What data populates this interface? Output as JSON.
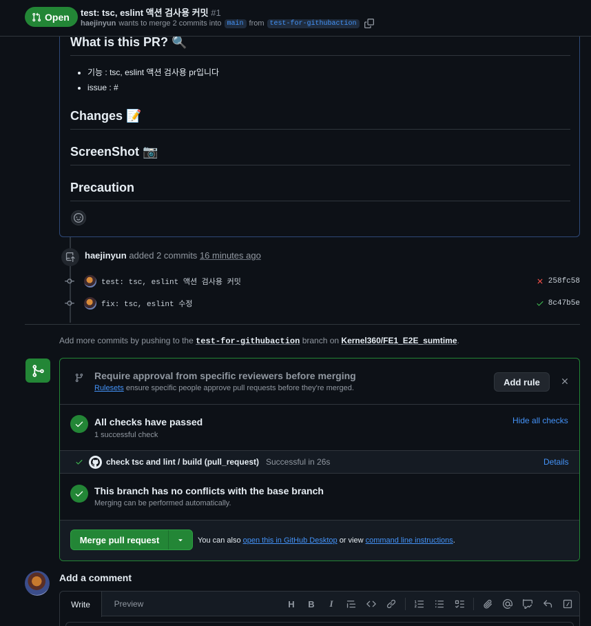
{
  "header": {
    "state": "Open",
    "title": "test: tsc, eslint 액션 검사용 커밋",
    "number": "#1",
    "author": "haejinyun",
    "merge_text": "wants to merge 2 commits into",
    "base_branch": "main",
    "from_text": "from",
    "head_branch": "test-for-githubaction"
  },
  "description": {
    "heading1": "What is this PR? 🔍",
    "items": [
      "기능 : tsc, eslint 액션 검사용 pr입니다",
      "issue : #"
    ],
    "heading2": "Changes 📝",
    "heading3": "ScreenShot 📷",
    "heading4": "Precaution"
  },
  "timeline": {
    "actor": "haejinyun",
    "action": "added 2 commits",
    "time": "16 minutes ago",
    "commits": [
      {
        "message": "test: tsc, eslint 액션 검사용 커밋",
        "sha": "258fc58",
        "status": "fail"
      },
      {
        "message": "fix: tsc, eslint 수정",
        "sha": "8c47b5e",
        "status": "pass"
      }
    ],
    "push_prefix": "Add more commits by pushing to the",
    "push_branch": "test-for-githubaction",
    "push_mid": "branch on",
    "push_repo": "Kernel360/FE1_E2E_sumtime",
    "push_end": "."
  },
  "merge_box": {
    "rule_title": "Require approval from specific reviewers before merging",
    "rule_link": "Rulesets",
    "rule_text": "ensure specific people approve pull requests before they're merged.",
    "add_rule": "Add rule",
    "checks_title": "All checks have passed",
    "checks_sub": "1 successful check",
    "hide_checks": "Hide all checks",
    "check_name": "check tsc and lint / build (pull_request)",
    "check_status": "Successful in 26s",
    "details": "Details",
    "conflict_title": "This branch has no conflicts with the base branch",
    "conflict_sub": "Merging can be performed automatically.",
    "merge_button": "Merge pull request",
    "also_prefix": "You can also",
    "also_link1": "open this in GitHub Desktop",
    "also_mid": "or view",
    "also_link2": "command line instructions",
    "also_end": "."
  },
  "comment": {
    "heading": "Add a comment",
    "tab_write": "Write",
    "tab_preview": "Preview",
    "toolbar": [
      "heading-icon",
      "bold-icon",
      "italic-icon",
      "quote-icon",
      "code-icon",
      "link-icon",
      "numbered-list-icon",
      "unordered-list-icon",
      "task-list-icon",
      "attach-icon",
      "mention-icon",
      "reference-icon",
      "reply-icon",
      "slash-icon"
    ]
  },
  "colors": {
    "accent_green": "#238636",
    "link_blue": "#4493f8",
    "fail_red": "#f85149",
    "background": "#0d1117"
  }
}
